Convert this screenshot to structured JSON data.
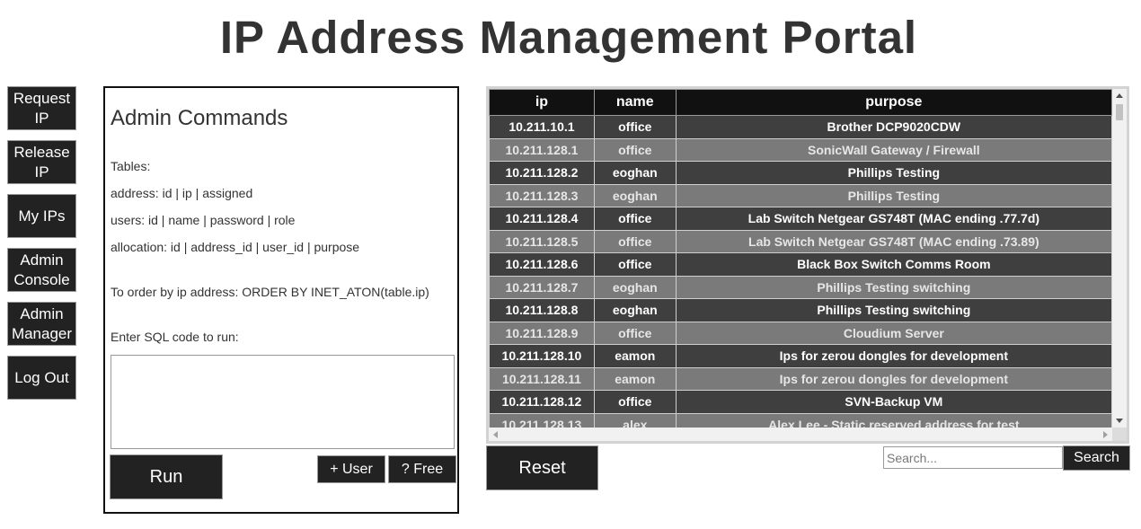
{
  "title": "IP Address Management Portal",
  "sidebar": {
    "buttons": [
      {
        "label_line1": "Request",
        "label_line2": "IP"
      },
      {
        "label_line1": "Release",
        "label_line2": "IP"
      },
      {
        "label_line1": "My IPs",
        "label_line2": ""
      },
      {
        "label_line1": "Admin",
        "label_line2": "Console"
      },
      {
        "label_line1": "Admin",
        "label_line2": "Manager"
      },
      {
        "label_line1": "Log Out",
        "label_line2": ""
      }
    ]
  },
  "admin": {
    "heading": "Admin Commands",
    "tables_label": "Tables:",
    "address_schema": "address: id | ip | assigned",
    "users_schema": "users: id | name | password | role",
    "allocation_schema": "allocation: id | address_id | user_id | purpose",
    "order_hint": "To order by ip address: ORDER BY INET_ATON(table.ip)",
    "sql_prompt": "Enter SQL code to run:",
    "sql_value": "",
    "run_label": "Run",
    "add_user_label": "+ User",
    "free_label": "? Free"
  },
  "table": {
    "headers": [
      "ip",
      "name",
      "purpose"
    ],
    "rows": [
      {
        "ip": "10.211.10.1",
        "name": "office",
        "purpose": "Brother DCP9020CDW"
      },
      {
        "ip": "10.211.128.1",
        "name": "office",
        "purpose": "SonicWall Gateway / Firewall"
      },
      {
        "ip": "10.211.128.2",
        "name": "eoghan",
        "purpose": "Phillips Testing"
      },
      {
        "ip": "10.211.128.3",
        "name": "eoghan",
        "purpose": "Phillips Testing"
      },
      {
        "ip": "10.211.128.4",
        "name": "office",
        "purpose": "Lab Switch Netgear GS748T (MAC ending .77.7d)"
      },
      {
        "ip": "10.211.128.5",
        "name": "office",
        "purpose": "Lab Switch Netgear GS748T (MAC ending .73.89)"
      },
      {
        "ip": "10.211.128.6",
        "name": "office",
        "purpose": "Black Box Switch Comms Room"
      },
      {
        "ip": "10.211.128.7",
        "name": "eoghan",
        "purpose": "Phillips Testing switching"
      },
      {
        "ip": "10.211.128.8",
        "name": "eoghan",
        "purpose": "Phillips Testing switching"
      },
      {
        "ip": "10.211.128.9",
        "name": "office",
        "purpose": "Cloudium Server"
      },
      {
        "ip": "10.211.128.10",
        "name": "eamon",
        "purpose": "Ips for zerou dongles for development"
      },
      {
        "ip": "10.211.128.11",
        "name": "eamon",
        "purpose": "Ips for zerou dongles for development"
      },
      {
        "ip": "10.211.128.12",
        "name": "office",
        "purpose": "SVN-Backup VM"
      },
      {
        "ip": "10.211.128.13",
        "name": "alex",
        "purpose": "Alex Lee - Static reserved address for test"
      }
    ]
  },
  "reset_label": "Reset",
  "search": {
    "placeholder": "Search...",
    "value": "",
    "button_label": "Search"
  },
  "colors": {
    "button_bg": "#222222",
    "row_dark": "#3f3f3f",
    "row_light": "#7a7a7a",
    "header_bg": "#111111"
  }
}
